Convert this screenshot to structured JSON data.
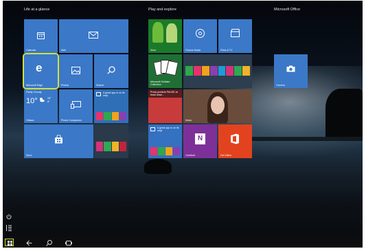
{
  "groups": {
    "life": "Life at a glance",
    "play": "Play and explore",
    "office": "Microsoft Office"
  },
  "tiles": {
    "calendar": "Calendar",
    "mail": "Mail",
    "edge": "Microsoft Edge",
    "photos": "Photos",
    "search": "Search",
    "weather_loc": "Partly Cloudy",
    "weather_temp": "10°",
    "weather_hi": "15°",
    "weather_lo": "8°",
    "weather_city": "Ottawa",
    "phone": "Phone Companion",
    "store_ad1": "A great app is on its way!",
    "store": "Store",
    "xbox": "Xbox",
    "groove": "Groove Music",
    "films": "Films & TV",
    "solitaire": "Microsoft Solitaire Collection",
    "news_headline": "Press predicts PAUSE at least down...",
    "news": "News",
    "store_ad2": "A great app is on its way!",
    "onenote": "OneNote",
    "getoffice": "Get Office",
    "camera": "Camera"
  },
  "taskbar": {
    "power_icon": "power-icon",
    "allapps_icon": "all-apps-icon",
    "back_icon": "back-arrow-icon",
    "search_icon": "search-icon",
    "taskview_icon": "task-view-icon"
  },
  "colors": {
    "tile_blue": "#3b78c8",
    "highlight": "#d2e13b",
    "onenote": "#7d3198",
    "office": "#e2431e"
  }
}
